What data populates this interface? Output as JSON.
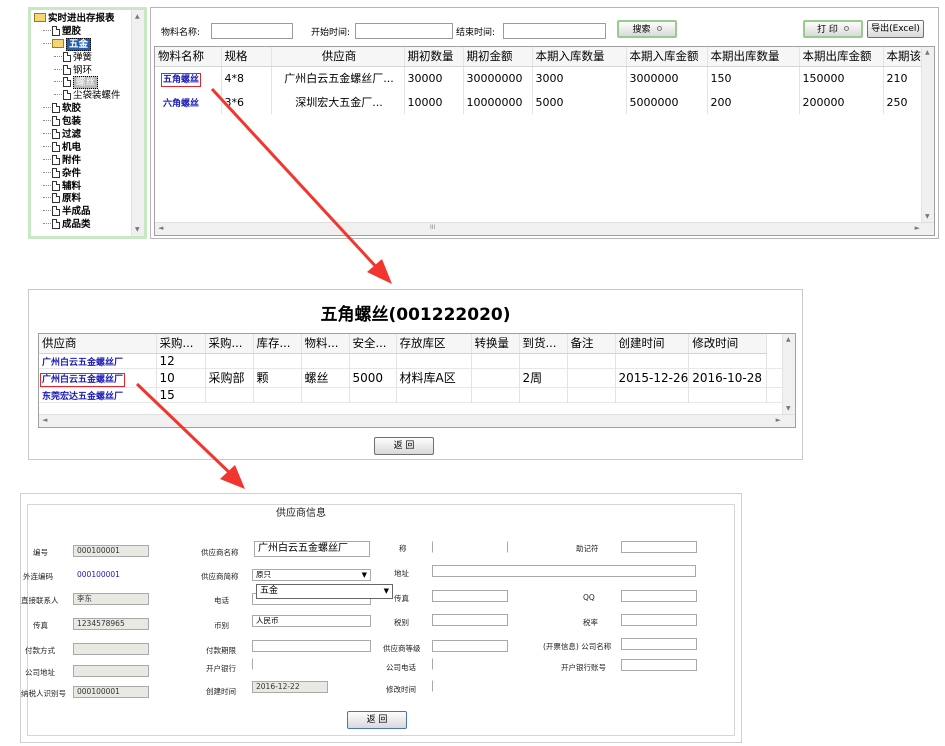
{
  "tree": {
    "root": "实时进出存报表",
    "items": [
      {
        "label": "塑胶",
        "level": 1,
        "selected": false
      },
      {
        "label": "五金",
        "level": 1,
        "selected": true,
        "folder": true
      },
      {
        "label": "弹簧",
        "level": 2
      },
      {
        "label": "钢环",
        "level": 2
      },
      {
        "label": "螺丝",
        "level": 2,
        "selected_gray": true
      },
      {
        "label": "尘袋装螺件",
        "level": 2
      },
      {
        "label": "软胶",
        "level": 1
      },
      {
        "label": "包装",
        "level": 1
      },
      {
        "label": "过滤",
        "level": 1
      },
      {
        "label": "机电",
        "level": 1
      },
      {
        "label": "附件",
        "level": 1
      },
      {
        "label": "杂件",
        "level": 1
      },
      {
        "label": "辅料",
        "level": 1
      },
      {
        "label": "原料",
        "level": 1
      },
      {
        "label": "半成品",
        "level": 1
      },
      {
        "label": "成品类",
        "level": 1
      }
    ]
  },
  "filters": {
    "material_label": "物料名称:",
    "start_label": "开始时间:",
    "end_label": "结束时间:",
    "search_button": "搜索",
    "print_button": "打 印",
    "export_button": "导出(Excel)"
  },
  "inventory_table": {
    "headers": [
      "物料名称",
      "规格",
      "供应商",
      "期初数量",
      "期初金额",
      "本期入库数量",
      "本期入库金额",
      "本期出库数量",
      "本期出库金额",
      "本期该"
    ],
    "rows": [
      [
        "五角螺丝",
        "4*8",
        "广州白云五金螺丝厂...",
        "30000",
        "30000000",
        "3000",
        "3000000",
        "150",
        "150000",
        "210"
      ],
      [
        "六角螺丝",
        "3*6",
        "深圳宏大五金厂...",
        "10000",
        "10000000",
        "5000",
        "5000000",
        "200",
        "200000",
        "250"
      ]
    ],
    "scroll_thumb": "III"
  },
  "detail": {
    "title": "五角螺丝(001222020)",
    "headers": [
      "供应商",
      "采购...",
      "采购...",
      "库存...",
      "物料...",
      "安全...",
      "存放库区",
      "转换量",
      "到货...",
      "备注",
      "创建时间",
      "修改时间"
    ],
    "rows": [
      [
        "广州白云五金螺丝厂",
        "12",
        "",
        "",
        "",
        "",
        "",
        "",
        "",
        "",
        "",
        ""
      ],
      [
        "广州白云五金螺丝厂",
        "10",
        "采购部",
        "颗",
        "螺丝",
        "5000",
        "材料库A区",
        "",
        "2周",
        "",
        "2015-12-26",
        "2016-10-28"
      ],
      [
        "东莞宏达五金螺丝厂",
        "15",
        "",
        "",
        "",
        "",
        "",
        "",
        "",
        "",
        "",
        ""
      ]
    ],
    "back_button": "返 回"
  },
  "supplier": {
    "title": "供应商信息",
    "fields": {
      "code_label": "编号",
      "code_value": "000100001",
      "ext_code_label": "外连编码",
      "ext_code_value": "000100001",
      "contact_label": "直接联系人",
      "contact_value": "李东",
      "fax_label": "传真",
      "fax_value": "1234578965",
      "pay_label": "付款方式",
      "pay_value": "",
      "address_label": "公司地址",
      "address_value": "",
      "taxid_label": "纳税人识别号",
      "taxid_value": "000100001",
      "name_label": "供应商名称",
      "name_value": "广州白云五金螺丝厂",
      "short_label": "供应商简称",
      "short_value": "原只",
      "phone_label": "电话",
      "phone_value": "",
      "category_value": "五金",
      "currency_label": "币别",
      "currency_value": "人民币",
      "pay_term_label": "付款期限",
      "pay_term_value": "",
      "bank_label": "开户银行",
      "bank_value": "",
      "created_label": "创建时间",
      "created_value": "2016-12-22",
      "nick_label": "称",
      "nick_value": "",
      "addr2_label": "地址",
      "addr2_value": "",
      "fax2_label": "传真",
      "fax2_value": "",
      "tax_label": "税别",
      "tax_value": "",
      "level_label": "供应商等级",
      "level_value": "",
      "company_phone_label": "公司电话",
      "company_phone_value": "",
      "modified_label": "修改时间",
      "modified_value": "",
      "mnemonic_label": "助记符",
      "mnemonic_value": "",
      "qq_label": "QQ",
      "qq_value": "",
      "tax_rate_label": "税率",
      "tax_rate_value": "",
      "invoice_label": "(开票信息) 公司名称",
      "invoice_value": "",
      "account_label": "开户银行账号",
      "account_value": ""
    },
    "back_button": "返 回"
  },
  "colors": {
    "arrow": "#f2352e",
    "tree_border": "#c6e8c2",
    "link": "#1a1ab8",
    "selection": "#1c5fb5"
  }
}
